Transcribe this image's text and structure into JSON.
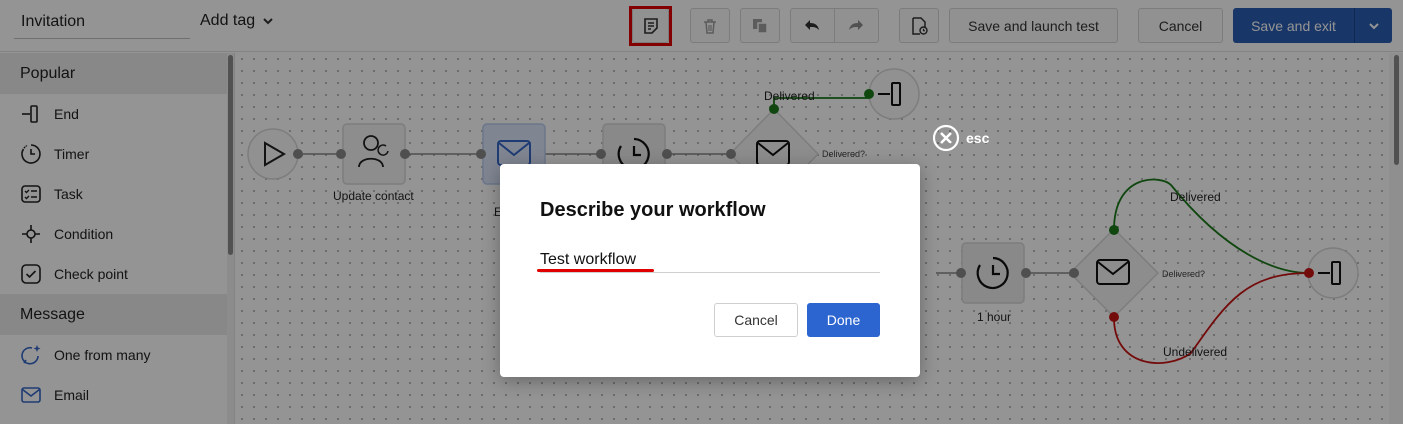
{
  "toolbar": {
    "workflow_name": "Invitation",
    "add_tag_label": "Add tag",
    "save_launch_label": "Save and launch test",
    "cancel_label": "Cancel",
    "save_exit_label": "Save and exit"
  },
  "sidebar": {
    "sections": [
      {
        "title": "Popular",
        "items": [
          {
            "label": "End",
            "icon": "end-icon"
          },
          {
            "label": "Timer",
            "icon": "timer-icon"
          },
          {
            "label": "Task",
            "icon": "task-icon"
          },
          {
            "label": "Condition",
            "icon": "condition-icon"
          },
          {
            "label": "Check point",
            "icon": "checkpoint-icon"
          }
        ]
      },
      {
        "title": "Message",
        "items": [
          {
            "label": "One from many",
            "icon": "sparkle-chat-icon"
          },
          {
            "label": "Email",
            "icon": "email-icon"
          }
        ]
      }
    ]
  },
  "canvas": {
    "labels": {
      "update_contact": "Update contact",
      "email_partial": "E",
      "delivered_top": "Delivered",
      "delivered_q1": "Delivered?",
      "one_hour": "1 hour",
      "delivered_right": "Delivered",
      "delivered_q2": "Delivered?",
      "undelivered": "Undelivered"
    },
    "colors": {
      "success": "#1a7a1a",
      "failure": "#c81414"
    }
  },
  "dialog": {
    "esc_label": "esc",
    "title": "Describe your workflow",
    "input_value": "Test workflow",
    "cancel_label": "Cancel",
    "done_label": "Done"
  }
}
